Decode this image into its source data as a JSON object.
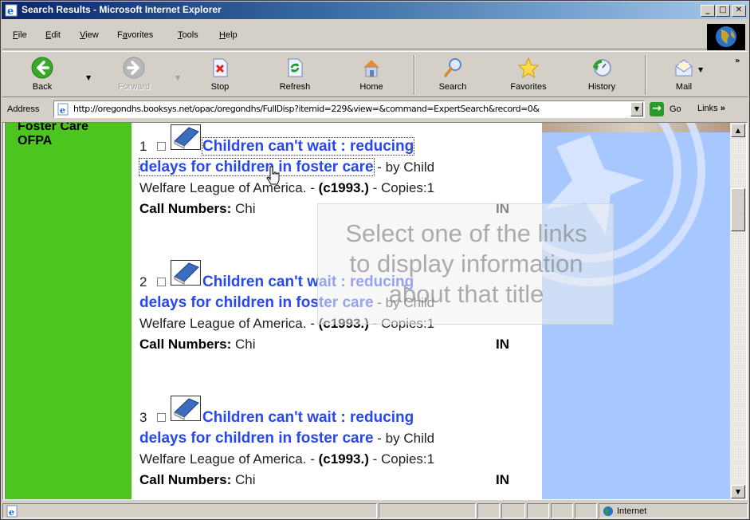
{
  "window": {
    "title": "Search Results - Microsoft Internet Explorer",
    "controls": [
      "minimize",
      "maximize",
      "close"
    ]
  },
  "menubar": {
    "items": [
      {
        "label": "File",
        "accel": "F"
      },
      {
        "label": "Edit",
        "accel": "E"
      },
      {
        "label": "View",
        "accel": "V"
      },
      {
        "label": "Favorites",
        "accel": "a"
      },
      {
        "label": "Tools",
        "accel": "T"
      },
      {
        "label": "Help",
        "accel": "H"
      }
    ]
  },
  "toolbar": {
    "back": "Back",
    "forward": "Forward",
    "stop": "Stop",
    "refresh": "Refresh",
    "home": "Home",
    "search": "Search",
    "favorites": "Favorites",
    "history": "History",
    "mail": "Mail",
    "more": "»"
  },
  "address": {
    "label": "Address",
    "url": "http://oregondhs.booksys.net/opac/oregondhs/FullDisp?itemid=229&view=&command=ExpertSearch&record=0&",
    "go": "Go",
    "links": "Links",
    "links_more": "»"
  },
  "sidebar": {
    "heading_line1": "Foster Care",
    "heading_line2": "OFPA",
    "color": "#4cc61e"
  },
  "results": {
    "call_label": "Call Numbers:",
    "items": [
      {
        "num": "1",
        "title_line1": "Children can't wait : reducing",
        "title_line2": "delays for children in foster care",
        "by": " - by Child",
        "author_rest": "Welfare League of America. - ",
        "date": "(c1993.)",
        "copies": " - Copies:1",
        "call": " Chi",
        "status": "IN"
      },
      {
        "num": "2",
        "title_line1": "Children can't wait : reducing",
        "title_line2": "delays for children in foster care",
        "by": " - by Child",
        "author_rest": "Welfare League of America. - ",
        "date": "(c1993.)",
        "copies": " - Copies:1",
        "call": " Chi",
        "status": "IN"
      },
      {
        "num": "3",
        "title_line1": "Children can't wait : reducing",
        "title_line2": "delays for children in foster care",
        "by": " - by Child",
        "author_rest": "Welfare League of America. - ",
        "date": "(c1993.)",
        "copies": " - Copies:1",
        "call": " Chi",
        "status": "IN"
      }
    ],
    "link_color": "#2747f0"
  },
  "tooltip": {
    "line1": "Select one of the links",
    "line2": "to display information",
    "line3": "about that title"
  },
  "statusbar": {
    "zone": "Internet"
  }
}
